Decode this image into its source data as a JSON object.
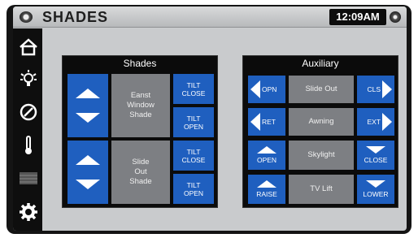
{
  "header": {
    "title": "SHADES",
    "clock": "12:09AM"
  },
  "sidebar": {
    "items": [
      {
        "icon": "home-icon"
      },
      {
        "icon": "light-bulb-icon"
      },
      {
        "icon": "disc-icon"
      },
      {
        "icon": "thermometer-icon"
      },
      {
        "icon": "shades-icon"
      },
      {
        "icon": "gear-icon"
      }
    ]
  },
  "shades_panel": {
    "title": "Shades",
    "rows": [
      {
        "name": "Eanst\nWindow\nShade",
        "tilt_close": "TILT\nCLOSE",
        "tilt_open": "TILT\nOPEN"
      },
      {
        "name": "Slide\nOut\nShade",
        "tilt_close": "TILT\nCLOSE",
        "tilt_open": "TILT\nOPEN"
      }
    ]
  },
  "auxiliary_panel": {
    "title": "Auxiliary",
    "rows": [
      {
        "left": "OPN",
        "name": "Slide Out",
        "right": "CLS"
      },
      {
        "left": "RET",
        "name": "Awning",
        "right": "EXT"
      },
      {
        "left": "OPEN",
        "name": "Skylight",
        "right": "CLOSE"
      },
      {
        "left": "RAISE",
        "name": "TV Lift",
        "right": "LOWER"
      }
    ]
  },
  "colors": {
    "accent": "#1f5fbf",
    "label_bg": "#7d7f83",
    "panel_bg": "#0b0b0b"
  }
}
